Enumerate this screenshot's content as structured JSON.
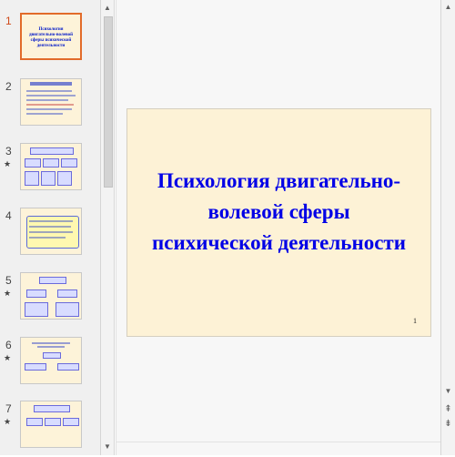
{
  "slides": [
    {
      "number": "1",
      "title": "Психология двигательно-волевой сферы психической деятельности",
      "active": true,
      "star": false
    },
    {
      "number": "2",
      "star": false
    },
    {
      "number": "3",
      "star": true
    },
    {
      "number": "4",
      "star": false
    },
    {
      "number": "5",
      "star": true
    },
    {
      "number": "6",
      "star": true
    },
    {
      "number": "7",
      "star": true
    }
  ],
  "current_slide": {
    "title": "Психология двигательно-волевой сферы психической деятельности",
    "title_lines": [
      "Психология двигательно-",
      "волевой сферы",
      "психической деятельности"
    ],
    "slide_number": "1"
  },
  "icons": {
    "star": "★",
    "up": "▲",
    "down": "▼",
    "page_prev": "⇞",
    "page_next": "⇟"
  },
  "colors": {
    "slide_background": "#fdf2d6",
    "title_color": "#0000e6",
    "active_border": "#e26b2a"
  }
}
